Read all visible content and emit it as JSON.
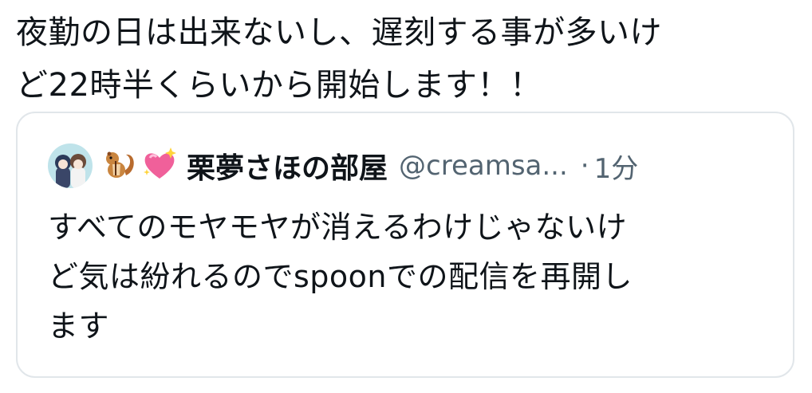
{
  "tweet": {
    "text": "夜勤の日は出来ないし、遅刻する事が多いけ\nど22時半くらいから開始します！！"
  },
  "quoted_tweet": {
    "display_name": "栗夢さほの部屋",
    "handle": "@creamsa...",
    "separator": "·",
    "time": "1分",
    "name_emojis": [
      "chipmunk-emoji",
      "sparkling-heart-emoji"
    ],
    "text": "すべてのモヤモヤが消えるわけじゃないけ\nど気は紛れるのでspoonでの配信を再開し\nます"
  },
  "colors": {
    "text_primary": "#0f1419",
    "text_secondary": "#536471",
    "card_border": "#e1e6ea",
    "heart_pink": "#f0609a"
  }
}
